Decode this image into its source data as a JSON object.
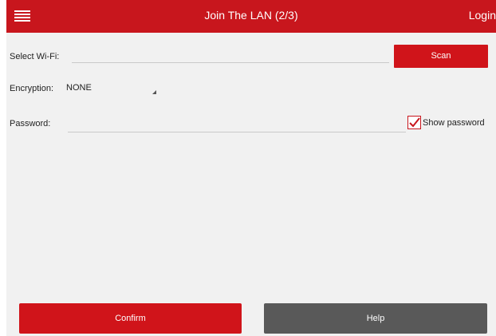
{
  "header": {
    "title": "Join The LAN (2/3)",
    "login_label": "Login",
    "menu_icon": "menu-icon"
  },
  "wifi": {
    "label": "Select Wi-Fi:",
    "value": "",
    "scan_label": "Scan"
  },
  "encryption": {
    "label": "Encryption:",
    "selected": "NONE"
  },
  "password": {
    "label": "Password:",
    "value": "",
    "show_password_label": "Show password",
    "show_password_checked": true
  },
  "footer": {
    "confirm_label": "Confirm",
    "help_label": "Help"
  },
  "colors": {
    "accent": "#c8161d",
    "secondary_button": "#595959",
    "background": "#f1f1f1"
  }
}
